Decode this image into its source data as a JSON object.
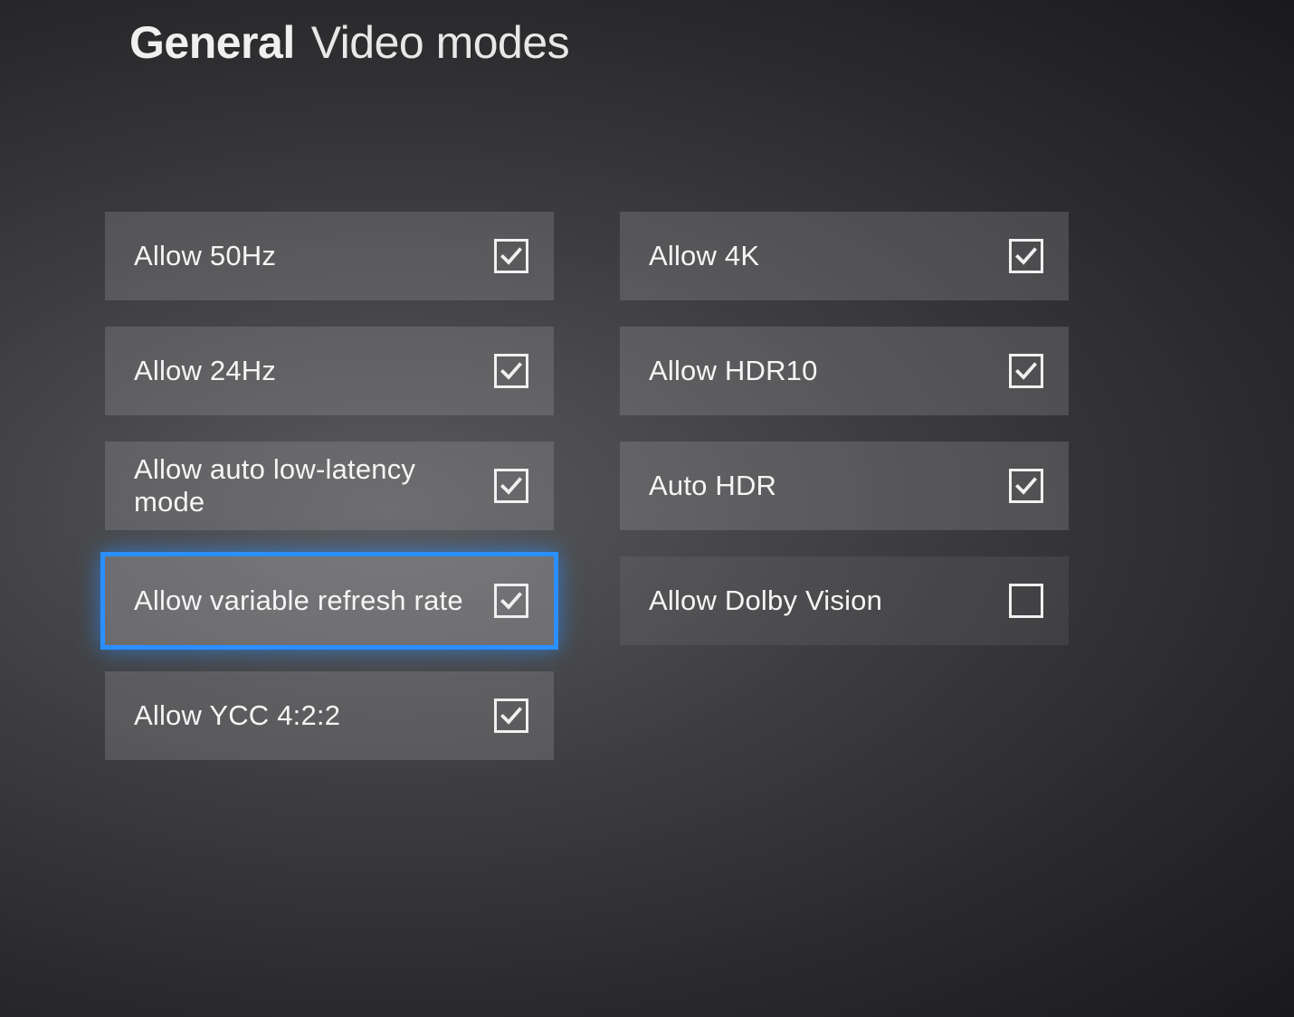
{
  "header": {
    "section": "General",
    "title": "Video modes"
  },
  "columns": {
    "left": [
      {
        "label": "Allow 50Hz",
        "checked": true,
        "selected": false,
        "dim": false
      },
      {
        "label": "Allow 24Hz",
        "checked": true,
        "selected": false,
        "dim": false
      },
      {
        "label": "Allow auto low-latency mode",
        "checked": true,
        "selected": false,
        "dim": false
      },
      {
        "label": "Allow variable refresh rate",
        "checked": true,
        "selected": true,
        "dim": false
      },
      {
        "label": "Allow YCC 4:2:2",
        "checked": true,
        "selected": false,
        "dim": false
      }
    ],
    "right": [
      {
        "label": "Allow 4K",
        "checked": true,
        "selected": false,
        "dim": false
      },
      {
        "label": "Allow HDR10",
        "checked": true,
        "selected": false,
        "dim": false
      },
      {
        "label": "Auto HDR",
        "checked": true,
        "selected": false,
        "dim": false
      },
      {
        "label": "Allow Dolby Vision",
        "checked": false,
        "selected": false,
        "dim": true
      }
    ]
  }
}
